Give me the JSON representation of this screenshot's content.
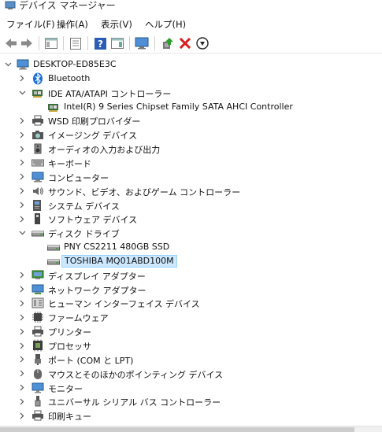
{
  "window": {
    "title": "デバイス マネージャー"
  },
  "menu": [
    "ファイル(F)",
    "操作(A)",
    "表示(V)",
    "ヘルプ(H)"
  ],
  "toolbar": [
    {
      "name": "back-button",
      "icon": "arrow-left-icon"
    },
    {
      "name": "forward-button",
      "icon": "arrow-right-icon"
    },
    {
      "name": "show-hide-tree-button",
      "icon": "console-tree-icon"
    },
    {
      "name": "properties-button",
      "icon": "properties-icon"
    },
    {
      "name": "help-button",
      "icon": "help-icon"
    },
    {
      "name": "action-pane-button",
      "icon": "action-pane-icon"
    },
    {
      "name": "scan-hardware-button",
      "icon": "monitor-scan-icon"
    },
    {
      "name": "update-driver-button",
      "icon": "update-driver-icon"
    },
    {
      "name": "uninstall-device-button",
      "icon": "red-x-icon"
    },
    {
      "name": "disable-device-button",
      "icon": "down-arrow-circle-icon"
    }
  ],
  "tree": {
    "root": "DESKTOP-ED85E3C",
    "items": [
      {
        "label": "Bluetooth",
        "icon": "bluetooth-icon",
        "level": 1,
        "expander": "collapsed"
      },
      {
        "label": "IDE ATA/ATAPI コントローラー",
        "icon": "ide-controller-icon",
        "level": 1,
        "expander": "expanded"
      },
      {
        "label": "Intel(R) 9 Series Chipset Family SATA AHCI Controller",
        "icon": "ide-controller-icon",
        "level": 2,
        "expander": "none"
      },
      {
        "label": "WSD 印刷プロバイダー",
        "icon": "printer-icon",
        "level": 1,
        "expander": "collapsed"
      },
      {
        "label": "イメージング デバイス",
        "icon": "camera-icon",
        "level": 1,
        "expander": "collapsed"
      },
      {
        "label": "オーディオの入力および出力",
        "icon": "speaker-icon",
        "level": 1,
        "expander": "collapsed"
      },
      {
        "label": "キーボード",
        "icon": "keyboard-icon",
        "level": 1,
        "expander": "collapsed"
      },
      {
        "label": "コンピューター",
        "icon": "computer-icon",
        "level": 1,
        "expander": "collapsed"
      },
      {
        "label": "サウンド、ビデオ、およびゲーム コントローラー",
        "icon": "sound-icon",
        "level": 1,
        "expander": "collapsed"
      },
      {
        "label": "システム デバイス",
        "icon": "system-device-icon",
        "level": 1,
        "expander": "collapsed"
      },
      {
        "label": "ソフトウェア デバイス",
        "icon": "software-device-icon",
        "level": 1,
        "expander": "collapsed"
      },
      {
        "label": "ディスク ドライブ",
        "icon": "disk-drive-icon",
        "level": 1,
        "expander": "expanded"
      },
      {
        "label": "PNY CS2211 480GB SSD",
        "icon": "disk-drive-icon",
        "level": 2,
        "expander": "none"
      },
      {
        "label": "TOSHIBA MQ01ABD100M",
        "icon": "disk-drive-icon",
        "level": 2,
        "expander": "none",
        "selected": true
      },
      {
        "label": "ディスプレイ アダプター",
        "icon": "display-adapter-icon",
        "level": 1,
        "expander": "collapsed"
      },
      {
        "label": "ネットワーク アダプター",
        "icon": "network-adapter-icon",
        "level": 1,
        "expander": "collapsed"
      },
      {
        "label": "ヒューマン インターフェイス デバイス",
        "icon": "hid-icon",
        "level": 1,
        "expander": "collapsed"
      },
      {
        "label": "ファームウェア",
        "icon": "firmware-icon",
        "level": 1,
        "expander": "collapsed"
      },
      {
        "label": "プリンター",
        "icon": "printer-icon",
        "level": 1,
        "expander": "collapsed"
      },
      {
        "label": "プロセッサ",
        "icon": "processor-icon",
        "level": 1,
        "expander": "collapsed"
      },
      {
        "label": "ポート (COM と LPT)",
        "icon": "port-icon",
        "level": 1,
        "expander": "collapsed"
      },
      {
        "label": "マウスとそのほかのポインティング デバイス",
        "icon": "mouse-icon",
        "level": 1,
        "expander": "collapsed"
      },
      {
        "label": "モニター",
        "icon": "monitor-icon",
        "level": 1,
        "expander": "collapsed"
      },
      {
        "label": "ユニバーサル シリアル バス コントローラー",
        "icon": "usb-icon",
        "level": 1,
        "expander": "collapsed"
      },
      {
        "label": "印刷キュー",
        "icon": "print-queue-icon",
        "level": 1,
        "expander": "collapsed"
      }
    ]
  },
  "colors": {
    "selection_bg": "#cce8ff",
    "selection_border": "#99d1ff",
    "accent_blue": "#1e73c8"
  }
}
